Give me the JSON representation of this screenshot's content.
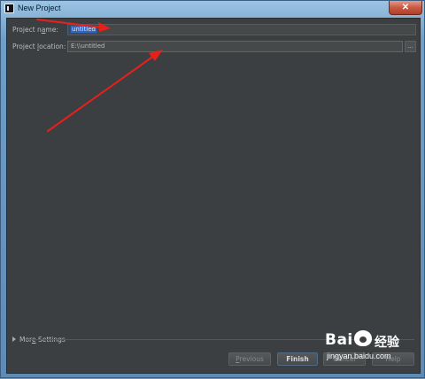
{
  "window": {
    "title": "New Project",
    "close_label": "✕"
  },
  "form": {
    "project_name_label_pre": "Project n",
    "project_name_label_u": "a",
    "project_name_label_post": "me:",
    "project_name_value": "untitled",
    "project_location_label_pre": "Project ",
    "project_location_label_u": "l",
    "project_location_label_post": "ocation:",
    "project_location_value": "E:\\\\untitled",
    "browse_label": "..."
  },
  "more_settings": {
    "pre": "Mor",
    "u": "e",
    "post": " Settings"
  },
  "buttons": {
    "previous_u": "P",
    "previous_post": "revious",
    "finish": "Finish",
    "cancel": "Cancel",
    "help": "Help"
  },
  "watermark": {
    "logo": "Bai",
    "logo2": "经验",
    "url": "jingyan.baidu.com"
  },
  "annotation_color": "#e8201a"
}
